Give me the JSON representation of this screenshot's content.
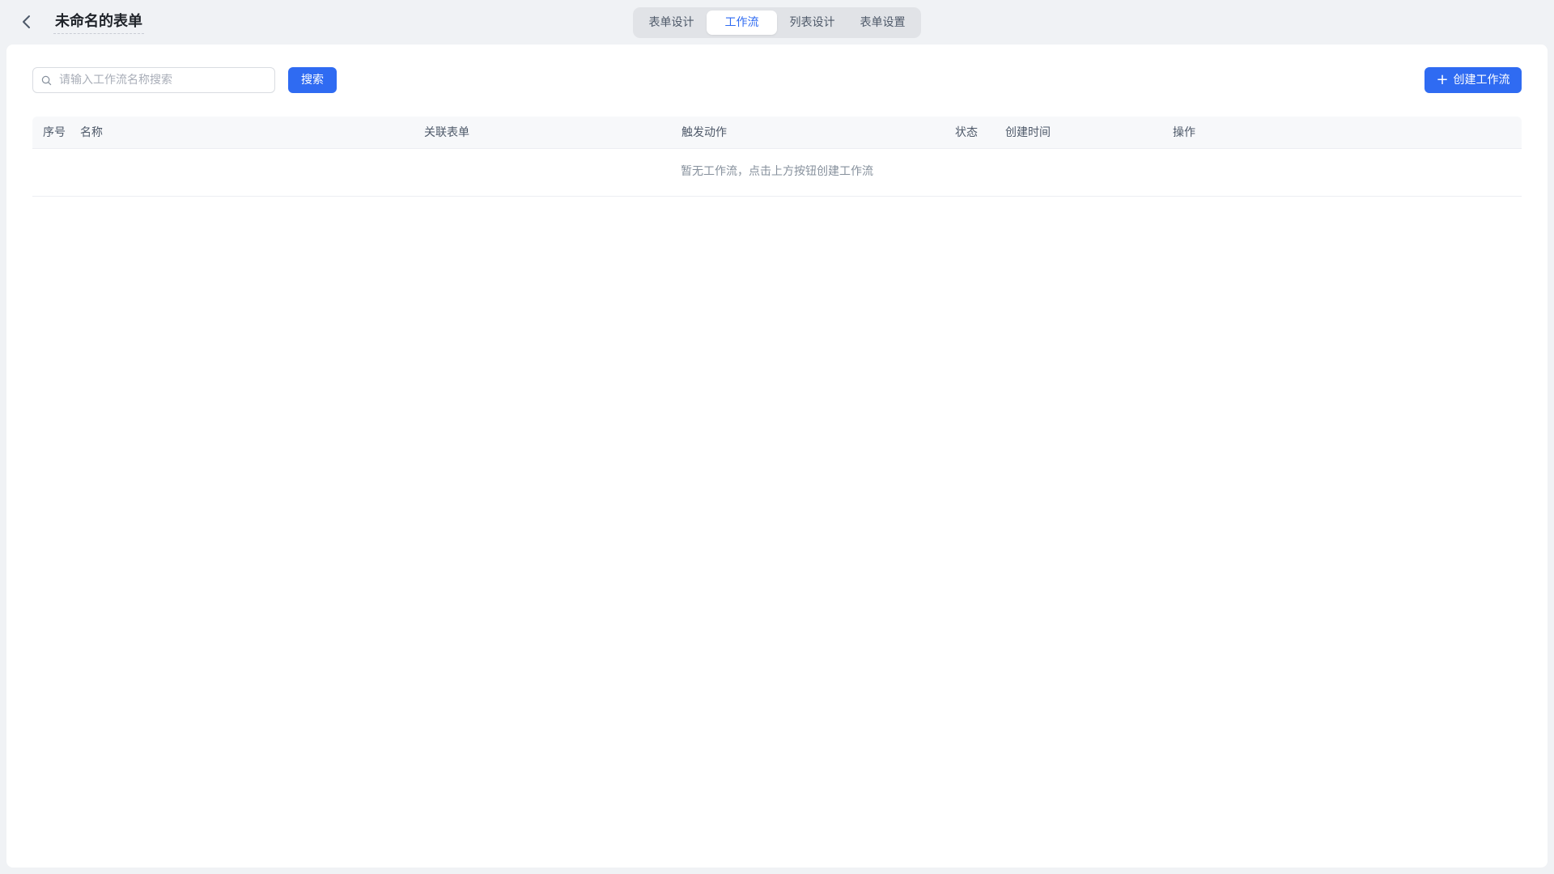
{
  "header": {
    "back_icon": "chevron-left-icon",
    "title": "未命名的表单",
    "tabs": [
      {
        "label": "表单设计",
        "active": false
      },
      {
        "label": "工作流",
        "active": true
      },
      {
        "label": "列表设计",
        "active": false
      },
      {
        "label": "表单设置",
        "active": false
      }
    ]
  },
  "toolbar": {
    "search_icon": "search-icon",
    "search_placeholder": "请输入工作流名称搜索",
    "search_value": "",
    "search_button": "搜索",
    "create_icon": "plus-icon",
    "create_button": "创建工作流"
  },
  "table": {
    "columns": [
      "序号",
      "名称",
      "关联表单",
      "触发动作",
      "状态",
      "创建时间",
      "操作"
    ],
    "rows": [],
    "empty_text": "暂无工作流，点击上方按钮创建工作流"
  },
  "colors": {
    "accent": "#2f6bf2",
    "page_background": "#f0f2f5",
    "panel_background": "#ffffff",
    "table_header_background": "#f7f8fa"
  }
}
